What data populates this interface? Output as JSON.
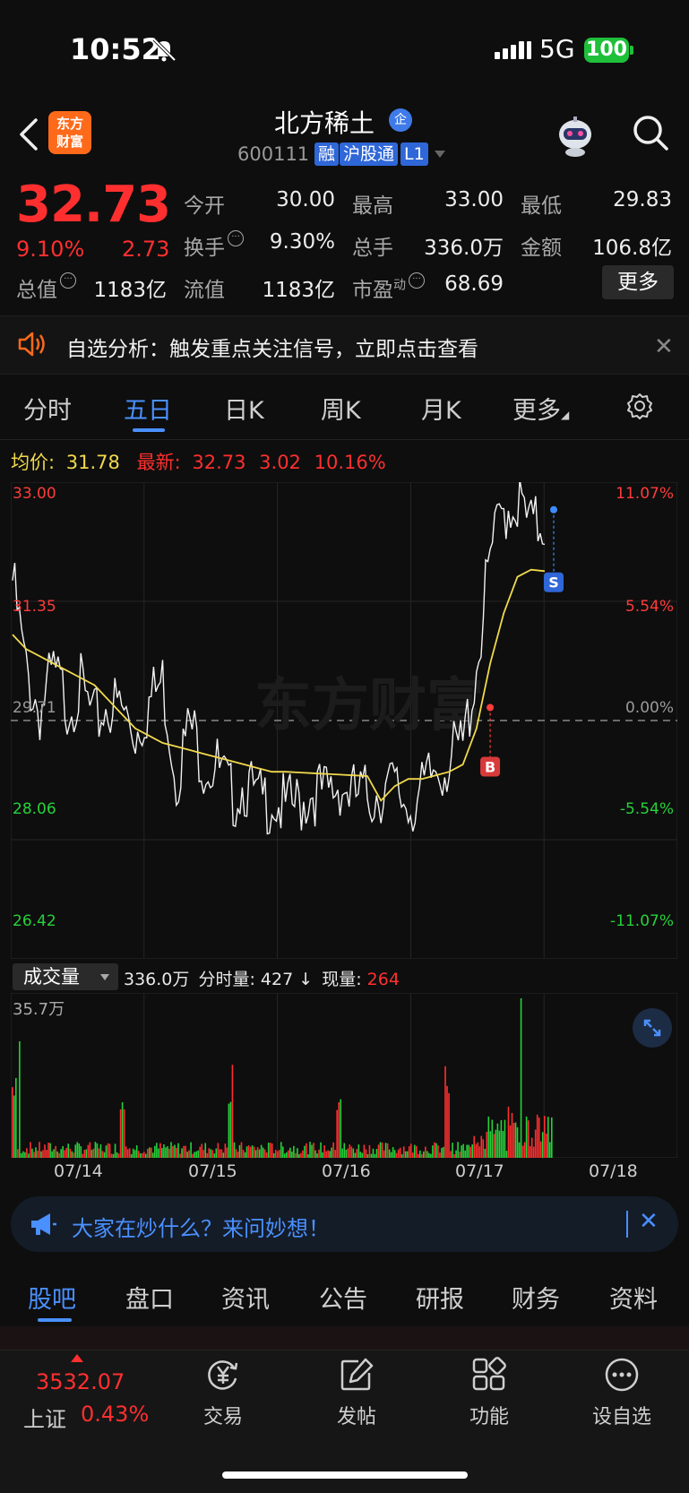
{
  "status_bar": {
    "time": "10:52",
    "network": "5G",
    "battery": "100"
  },
  "header": {
    "app_logo": "东方财富",
    "stock_name": "北方稀土",
    "enterprise_badge": "企",
    "stock_code": "600111",
    "tags": [
      "融",
      "沪股通",
      "L1"
    ]
  },
  "quote": {
    "price": "32.73",
    "change_pct": "9.10%",
    "change": "2.73",
    "fields": [
      {
        "label": "今开",
        "value": "30.00",
        "color": "#ededed"
      },
      {
        "label": "最高",
        "value": "33.00",
        "color": "#ff2f2f"
      },
      {
        "label": "最低",
        "value": "29.83",
        "color": "#27d13a"
      },
      {
        "label": "换手",
        "value": "9.30%",
        "color": "#ededed"
      },
      {
        "label": "总手",
        "value": "336.0万",
        "color": "#ededed"
      },
      {
        "label": "金额",
        "value": "106.8亿",
        "color": "#ededed"
      },
      {
        "label": "总值",
        "value": "1183亿",
        "color": "#ededed"
      },
      {
        "label": "流值",
        "value": "1183亿",
        "color": "#ededed"
      },
      {
        "label": "市盈",
        "sup": "动",
        "value": "68.69",
        "color": "#ededed"
      }
    ],
    "more_label": "更多"
  },
  "notice": {
    "text": "自选分析：触发重点关注信号，立即点击查看"
  },
  "period_tabs": [
    "分时",
    "五日",
    "日K",
    "周K",
    "月K",
    "更多"
  ],
  "active_tab": "五日",
  "avg_line": {
    "avg_label": "均价:",
    "avg_value": "31.78",
    "latest_label": "最新:",
    "latest_value": "32.73",
    "latest_change": "3.02",
    "latest_pct": "10.16%"
  },
  "chart_data": {
    "type": "line",
    "title": "",
    "x": [
      "07/14",
      "07/15",
      "07/16",
      "07/17",
      "07/18"
    ],
    "price_ticks_left": [
      "33.00",
      "31.35",
      "29.71",
      "28.06",
      "26.42"
    ],
    "pct_ticks_right": [
      "11.07%",
      "5.54%",
      "0.00%",
      "-5.54%",
      "-11.07%"
    ],
    "baseline": 29.71,
    "ylim": [
      26.42,
      33.0
    ],
    "series": [
      {
        "name": "",
        "values": [
          31.9,
          30.6,
          30.1,
          30.6,
          30.2,
          30.4,
          29.9,
          30.2,
          30.1,
          29.8,
          30.2,
          30.5,
          29.2,
          29.9,
          29.4,
          29.3,
          28.9,
          29.1,
          28.8,
          28.9,
          28.7,
          28.8,
          29.0,
          28.9,
          29.1,
          28.9,
          28.9,
          29.0,
          29.0,
          28.8,
          28.9,
          29.3,
          29.4,
          29.6,
          30.7,
          32.2,
          32.9,
          33.0,
          32.6,
          32.73
        ]
      },
      {
        "name": "",
        "values": [
          30.9,
          30.7,
          30.6,
          30.5,
          30.4,
          30.3,
          30.2,
          30.0,
          29.8,
          29.6,
          29.5,
          29.4,
          29.35,
          29.3,
          29.25,
          29.2,
          29.15,
          29.1,
          29.05,
          29.0,
          29.0,
          28.99,
          28.98,
          28.97,
          28.96,
          28.95,
          28.94,
          28.6,
          28.8,
          28.9,
          28.9,
          28.95,
          29.0,
          29.1,
          29.6,
          30.5,
          31.2,
          31.7,
          31.8,
          31.78
        ]
      }
    ],
    "markers": [
      {
        "label": "B",
        "value": 29.89
      },
      {
        "label": "S",
        "value": 32.73
      }
    ]
  },
  "volume": {
    "selector": "成交量",
    "total": "336.0万",
    "minute_label": "分时量:",
    "minute_value": "427",
    "arrow": "↓",
    "current_label": "现量:",
    "current_value": "264",
    "max_label": "35.7万",
    "date_labels": [
      "07/14",
      "07/15",
      "07/16",
      "07/17",
      "07/18"
    ]
  },
  "banner": {
    "text": "大家在炒什么？来问妙想！"
  },
  "bottom_tabs": [
    "股吧",
    "盘口",
    "资讯",
    "公告",
    "研报",
    "财务",
    "资料"
  ],
  "bottom_nav": {
    "index_value": "3532.07",
    "index_name": "上证",
    "index_pct": "0.43%",
    "items": [
      {
        "label": "交易",
        "icon": "yen-exchange-icon"
      },
      {
        "label": "发帖",
        "icon": "compose-icon"
      },
      {
        "label": "功能",
        "icon": "grid-icon"
      },
      {
        "label": "设自选",
        "icon": "more-circle-icon"
      }
    ]
  },
  "colors": {
    "up": "#ff2f2f",
    "down": "#27d13a",
    "accent": "#4a90ff",
    "avg_line": "#f1d94c"
  }
}
